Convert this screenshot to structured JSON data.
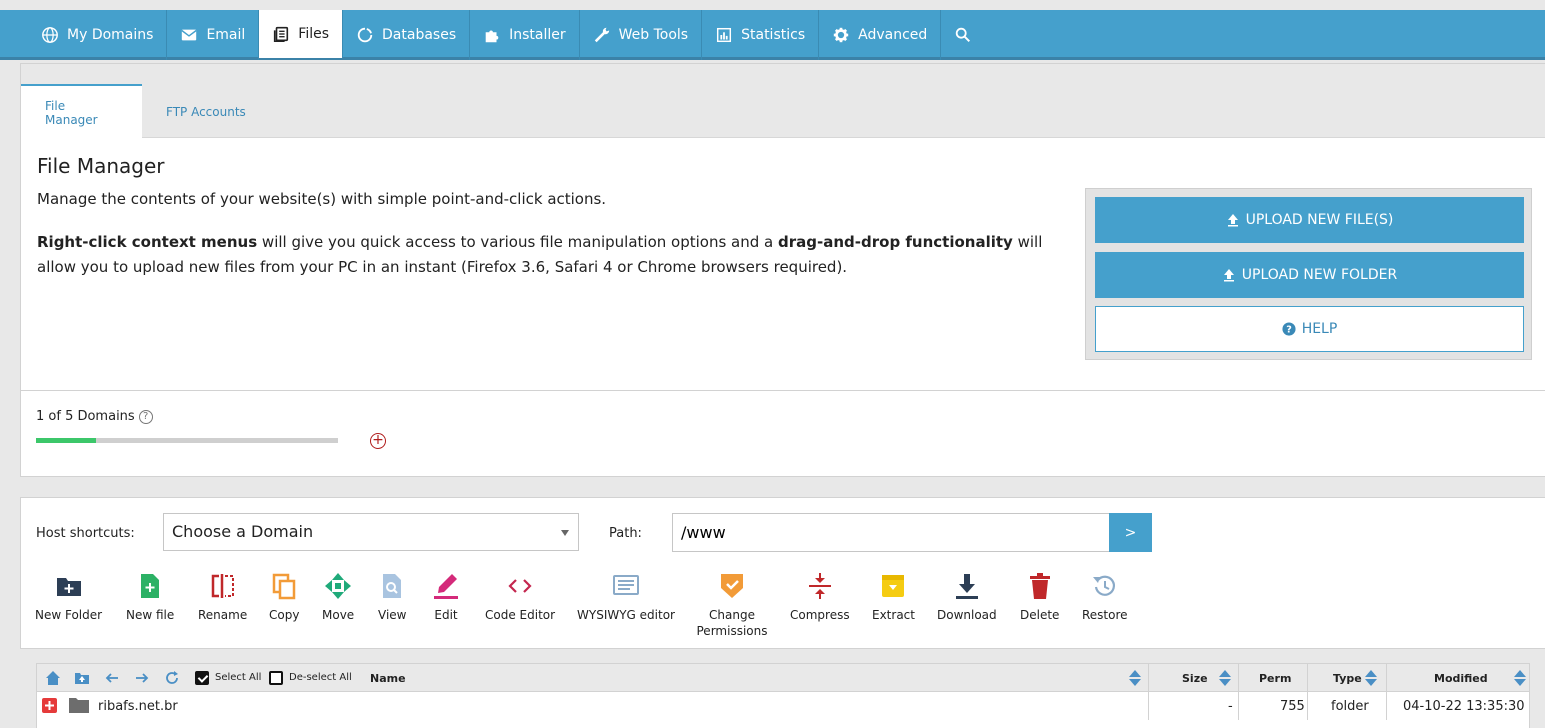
{
  "nav": {
    "items": [
      {
        "label": "My Domains",
        "icon": "globe-icon"
      },
      {
        "label": "Email",
        "icon": "envelope-icon"
      },
      {
        "label": "Files",
        "icon": "files-icon"
      },
      {
        "label": "Databases",
        "icon": "database-icon"
      },
      {
        "label": "Installer",
        "icon": "puzzle-icon"
      },
      {
        "label": "Web Tools",
        "icon": "wrench-icon"
      },
      {
        "label": "Statistics",
        "icon": "chart-icon"
      },
      {
        "label": "Advanced",
        "icon": "gear-icon"
      }
    ],
    "active": "Files"
  },
  "tabs": {
    "file_manager": "File Manager",
    "ftp_accounts": "FTP Accounts"
  },
  "intro": {
    "title": "File Manager",
    "desc": "Manage the contents of your website(s) with simple point-and-click actions.",
    "bold1": "Right-click context menus",
    "text1": " will give you quick access to various file manipulation options and a ",
    "bold2": "drag-and-drop functionality",
    "text2": " will allow you to upload new files from your PC in an instant (Firefox 3.6, Safari 4 or Chrome browsers required)."
  },
  "upload": {
    "new_files": "UPLOAD NEW FILE(S)",
    "new_folder": "UPLOAD NEW FOLDER",
    "help": "HELP"
  },
  "domains": {
    "label": "1 of 5 Domains",
    "used": 1,
    "total": 5
  },
  "shortcuts": {
    "host_label": "Host shortcuts:",
    "host_value": "Choose a Domain",
    "path_label": "Path:",
    "path_value": "/www",
    "go": ">"
  },
  "toolbar": {
    "new_folder": "New Folder",
    "new_file": "New file",
    "rename": "Rename",
    "copy": "Copy",
    "move": "Move",
    "view": "View",
    "edit": "Edit",
    "code_editor": "Code Editor",
    "wysiwyg": "WYSIWYG editor",
    "change_permissions": "Change Permissions",
    "compress": "Compress",
    "extract": "Extract",
    "download": "Download",
    "delete": "Delete",
    "restore": "Restore"
  },
  "table": {
    "select_all": "Select All",
    "deselect_all": "De-select All",
    "columns": {
      "name": "Name",
      "size": "Size",
      "perm": "Perm",
      "type": "Type",
      "modified": "Modified"
    },
    "rows": [
      {
        "name": "ribafs.net.br",
        "size": "-",
        "perm": "755",
        "type": "folder",
        "modified": "04-10-22 13:35:30"
      }
    ]
  },
  "colors": {
    "accent": "#45a0cc",
    "progress": "#3cc76a",
    "danger": "#b01c1c"
  }
}
